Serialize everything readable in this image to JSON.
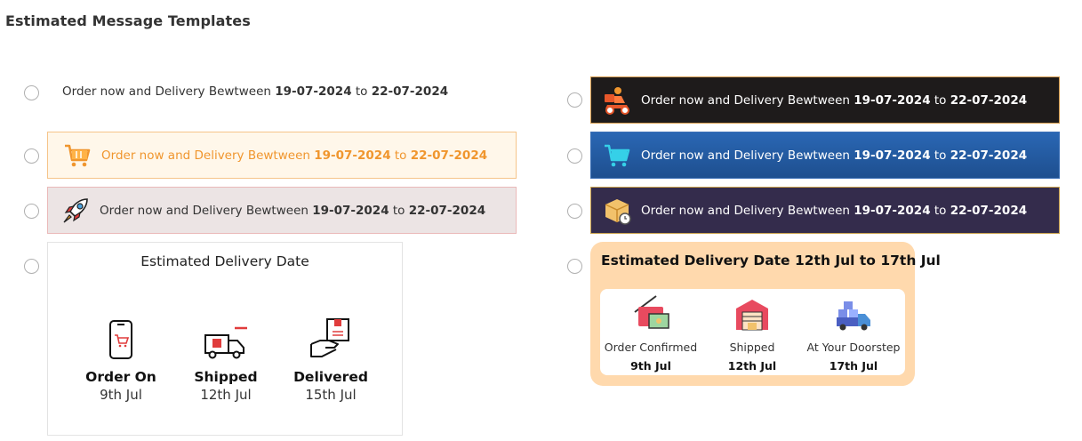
{
  "page": {
    "title": "Estimated Message Templates"
  },
  "template_text": {
    "prefix": "Order now and Delivery Bewtween",
    "start_date": "19-07-2024",
    "connector": "to",
    "end_date": "22-07-2024"
  },
  "icons": {
    "scooter": "delivery-scooter-icon",
    "cart_orange": "shopping-cart-icon",
    "rocket": "rocket-icon",
    "cart_blue": "shopping-cart-icon",
    "box_clock": "package-clock-icon"
  },
  "card_simple": {
    "title": "Estimated Delivery Date",
    "steps": [
      {
        "label": "Order On",
        "date": "9th Jul",
        "icon": "mobile-cart-icon"
      },
      {
        "label": "Shipped",
        "date": "12th Jul",
        "icon": "delivery-truck-icon"
      },
      {
        "label": "Delivered",
        "date": "15th Jul",
        "icon": "hand-package-icon"
      }
    ]
  },
  "card_orange": {
    "title": "Estimated Delivery Date 12th Jul to 17th Jul",
    "steps": [
      {
        "label": "Order Confirmed",
        "date": "9th Jul",
        "icon": "card-payment-icon"
      },
      {
        "label": "Shipped",
        "date": "12th Jul",
        "icon": "warehouse-icon"
      },
      {
        "label": "At Your Doorstep",
        "date": "17th Jul",
        "icon": "truck-boxes-icon"
      }
    ]
  },
  "colors": {
    "orange_text": "#f0962e",
    "orange_bg": "#fff7ea",
    "dark_bg": "#1e1b1b",
    "blue_bg": "#2a67b4",
    "purple_bg": "#342c4c",
    "peach_card": "#ffd9ad"
  }
}
